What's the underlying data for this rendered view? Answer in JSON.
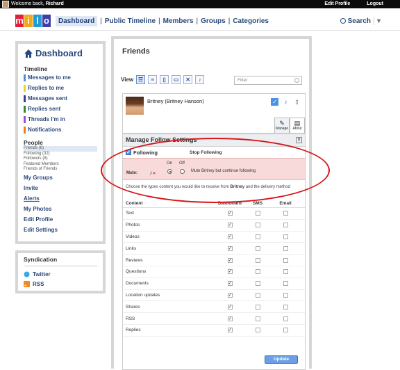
{
  "topbar": {
    "welcome_prefix": "Welcome back,",
    "user_name": "Richard",
    "edit_profile": "Edit Profile",
    "logout": "Logout"
  },
  "logo": {
    "letters": [
      "m",
      "i",
      "l",
      "o"
    ],
    "colors": [
      "#e01f3d",
      "#f0a81c",
      "#1f9bd6",
      "#3d3fa8"
    ]
  },
  "nav": {
    "items": [
      {
        "label": "Dashboard",
        "active": true
      },
      {
        "label": "Public Timeline"
      },
      {
        "label": "Members"
      },
      {
        "label": "Groups"
      },
      {
        "label": "Categories"
      }
    ],
    "separator": "|",
    "search_label": "Search",
    "search_chevron": "▾"
  },
  "sidebar": {
    "title": "Dashboard",
    "timeline_header": "Timeline",
    "timeline_items": [
      {
        "label": "Messages to me",
        "color": "#4a8fe0"
      },
      {
        "label": "Replies to me",
        "color": "#f2d21a"
      },
      {
        "label": "Messages sent",
        "color": "#3a3c8a"
      },
      {
        "label": "Replies sent",
        "color": "#2e8a2e"
      },
      {
        "label": "Threads I'm in",
        "color": "#9a4fd0"
      },
      {
        "label": "Notifications",
        "color": "#f07a1a"
      }
    ],
    "people_header": "People",
    "people_items": [
      "Friends (6)",
      "Following (32)",
      "Followers (8)",
      "Featured Members",
      "Friends of Friends"
    ],
    "other_items": [
      "My Groups",
      "Invite",
      "Alerts",
      "My Photos",
      "Edit Profile",
      "Edit Settings"
    ]
  },
  "syndication": {
    "title": "Syndication",
    "items": [
      "Twitter",
      "RSS"
    ]
  },
  "main": {
    "title": "Friends",
    "view_label": "View",
    "filter_placeholder": "Filter",
    "friend": {
      "name": "Britney (Britney Hanson)",
      "tab_manage": "Manage",
      "tab_about": "About"
    },
    "manage": {
      "title": "Manage Follow Settings",
      "close": "x",
      "following": "Following",
      "stop_following": "Stop Following",
      "mute_label": "Mute:",
      "on_label": "On",
      "off_label": "Off",
      "mute_text": "Mute Britney but continue following",
      "choose_prefix": "Choose the types content you would like to receive from",
      "choose_name": "Britney",
      "choose_suffix": "and the delivery method",
      "columns": [
        "Content",
        "Dashboard",
        "SMS",
        "Email"
      ],
      "rows": [
        "Text",
        "Photos",
        "Videos",
        "Links",
        "Reviews",
        "Questions",
        "Documents",
        "Location updates",
        "Shares",
        "RSS",
        "Replies"
      ],
      "update_button": "Update"
    }
  }
}
